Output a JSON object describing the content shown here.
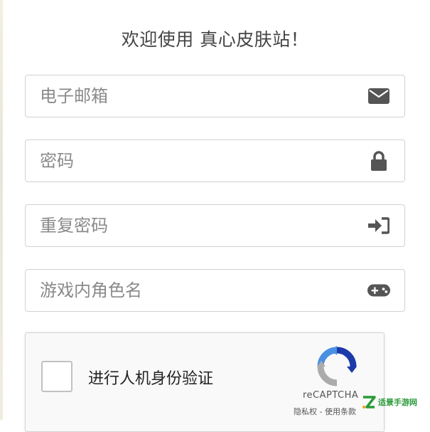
{
  "header": {
    "title": "欢迎使用 真心皮肤站！"
  },
  "form": {
    "email": {
      "placeholder": "电子邮箱",
      "icon": "envelope-icon"
    },
    "password": {
      "placeholder": "密码",
      "icon": "lock-icon"
    },
    "confirm_password": {
      "placeholder": "重复密码",
      "icon": "sign-in-icon"
    },
    "game_name": {
      "placeholder": "游戏内角色名",
      "icon": "gamepad-icon"
    }
  },
  "captcha": {
    "label": "进行人机身份验证",
    "brand": "reCAPTCHA",
    "terms": "隐私权 - 使用条款",
    "checked": false
  },
  "watermark": {
    "text": "适景手游网"
  },
  "colors": {
    "icon": "#555555",
    "border": "#d2d2d2",
    "placeholder": "#8a8a8a"
  }
}
